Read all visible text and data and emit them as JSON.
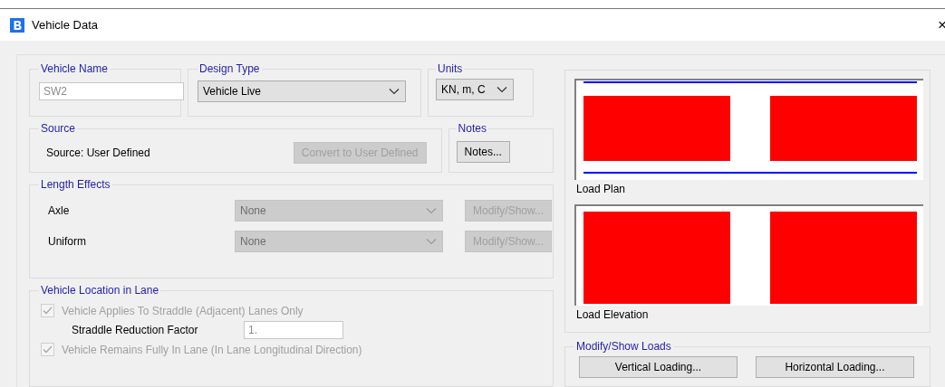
{
  "window": {
    "title": "Vehicle Data",
    "close": "×"
  },
  "vehicle_name": {
    "legend": "Vehicle Name",
    "value": "SW2"
  },
  "design_type": {
    "legend": "Design Type",
    "value": "Vehicle Live",
    "disabled": false
  },
  "units": {
    "legend": "Units",
    "value": "KN, m, C",
    "disabled": false
  },
  "source": {
    "legend": "Source",
    "text": "Source: User Defined",
    "button": {
      "label": "Convert to User Defined",
      "disabled": true
    }
  },
  "notes": {
    "legend": "Notes",
    "button": {
      "label": "Notes...",
      "disabled": false
    }
  },
  "length_effects": {
    "legend": "Length Effects",
    "rows": [
      {
        "label": "Axle",
        "value": "None",
        "disabled": true,
        "button": {
          "label": "Modify/Show...",
          "disabled": true
        }
      },
      {
        "label": "Uniform",
        "value": "None",
        "disabled": true,
        "button": {
          "label": "Modify/Show...",
          "disabled": true
        }
      }
    ]
  },
  "vehicle_location": {
    "legend": "Vehicle Location in Lane",
    "items": [
      {
        "kind": "checkbox",
        "label": "Vehicle Applies To Straddle (Adjacent) Lanes Only",
        "checked": true,
        "disabled": true
      },
      {
        "kind": "field",
        "label": "Straddle Reduction Factor",
        "value": "1."
      },
      {
        "kind": "checkbox",
        "label": "Vehicle Remains Fully In Lane (In Lane Longitudinal Direction)",
        "checked": true,
        "disabled": true
      }
    ]
  },
  "preview": {
    "plan_label": "Load Plan",
    "elevation_label": "Load Elevation"
  },
  "modify_show_loads": {
    "legend": "Modify/Show Loads",
    "buttons": [
      {
        "label": "Vertical Loading...",
        "disabled": false
      },
      {
        "label": "Horizontal Loading...",
        "disabled": false
      }
    ]
  }
}
